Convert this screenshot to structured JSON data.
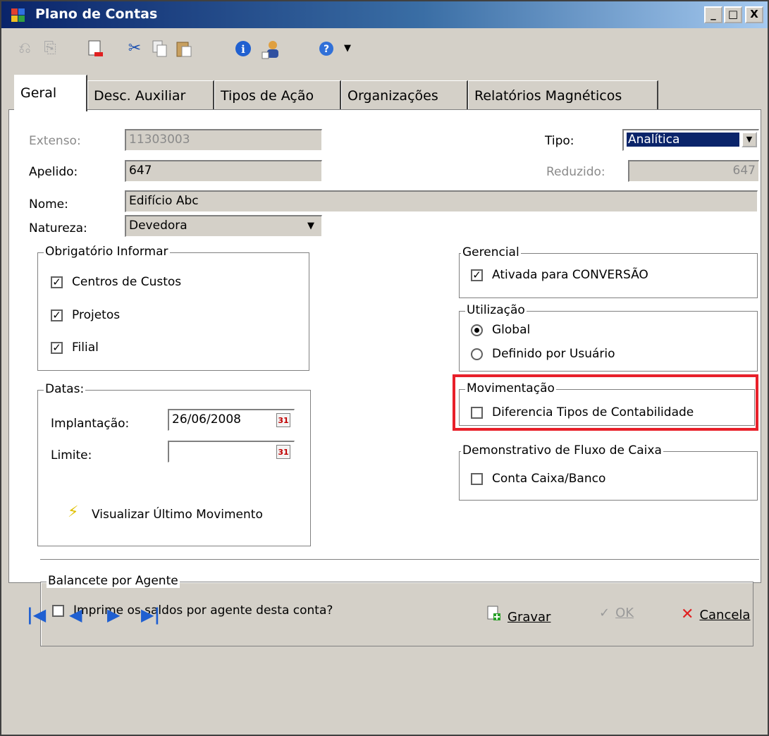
{
  "window": {
    "title": "Plano de Contas",
    "controls": [
      "_",
      "□",
      "X"
    ]
  },
  "toolbar": {
    "icons": [
      "undo-icon",
      "redo-icon",
      "new-document-icon",
      "cut-icon",
      "copy-icon",
      "paste-icon",
      "info-icon",
      "user-icon",
      "help-icon"
    ]
  },
  "tabs": [
    {
      "label": "Geral",
      "active": true
    },
    {
      "label": "Desc. Auxiliar",
      "active": false
    },
    {
      "label": "Tipos de Ação",
      "active": false
    },
    {
      "label": "Organizações",
      "active": false
    },
    {
      "label": "Relatórios Magnéticos",
      "active": false
    }
  ],
  "form": {
    "extenso_label": "Extenso:",
    "extenso_value": "11303003",
    "apelido_label": "Apelido:",
    "apelido_value": "647",
    "nome_label": "Nome:",
    "nome_value": "Edifício Abc",
    "natureza_label": "Natureza:",
    "natureza_value": "Devedora",
    "tipo_label": "Tipo:",
    "tipo_value": "Analítica",
    "reduzido_label": "Reduzido:",
    "reduzido_value": "647"
  },
  "obrigatorio": {
    "title": "Obrigatório Informar",
    "items": [
      {
        "label": "Centros de Custos",
        "checked": true
      },
      {
        "label": "Projetos",
        "checked": true
      },
      {
        "label": "Filial",
        "checked": true
      }
    ]
  },
  "datas": {
    "title": "Datas:",
    "implantacao_label": "Implantação:",
    "implantacao_value": "26/06/2008",
    "limite_label": "Limite:",
    "limite_value": "",
    "calendar_glyph": "31",
    "visualizar_label": "Visualizar Último Movimento"
  },
  "gerencial": {
    "title": "Gerencial",
    "item_label": "Ativada para CONVERSÃO",
    "checked": true
  },
  "utilizacao": {
    "title": "Utilização",
    "options": [
      {
        "label": "Global",
        "selected": true
      },
      {
        "label": "Definido por Usuário",
        "selected": false
      }
    ]
  },
  "movimentacao": {
    "title": "Movimentação",
    "item_label": "Diferencia Tipos de Contabilidade",
    "checked": false,
    "highlight_color": "#e8202a"
  },
  "fluxo": {
    "title": "Demonstrativo de Fluxo de Caixa",
    "item_label": "Conta Caixa/Banco",
    "checked": false
  },
  "balancete": {
    "title": "Balancete por Agente",
    "item_label": "Imprime os saldos por agente desta conta?",
    "checked": false
  },
  "footer": {
    "nav_icons": [
      "first-record-icon",
      "previous-record-icon",
      "next-record-icon",
      "last-record-icon"
    ],
    "gravar_label": "Gravar",
    "ok_label": "OK",
    "cancela_label": "Cancela"
  },
  "colors": {
    "title_start": "#0a246a",
    "title_end": "#a6caf0",
    "face": "#d4d0c8",
    "selection": "#0a246a",
    "nav_blue": "#1f5fd1"
  }
}
